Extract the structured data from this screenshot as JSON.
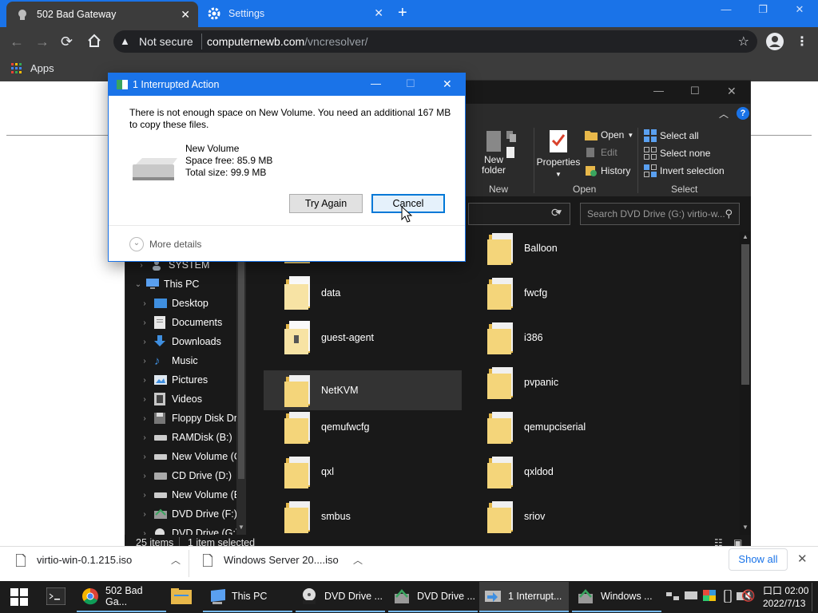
{
  "browser": {
    "tabs": [
      {
        "title": "502 Bad Gateway"
      },
      {
        "title": "Settings"
      }
    ],
    "security_label": "Not secure",
    "url_host": "computernewb.com",
    "url_path": "/vncresolver/",
    "bookmarks": {
      "apps_label": "Apps"
    }
  },
  "dialog": {
    "title": "1 Interrupted Action",
    "message": "There is not enough space on New Volume. You need an additional 167 MB to copy these files.",
    "drive_name": "New Volume",
    "space_free": "Space free: 85.9 MB",
    "total_size": "Total size: 99.9 MB",
    "try_again_label": "Try Again",
    "cancel_label": "Cancel",
    "more_details_label": "More details"
  },
  "explorer": {
    "ribbon": {
      "new_folder_label": "New folder",
      "properties_label": "Properties",
      "open_label": "Open",
      "edit_label": "Edit",
      "history_label": "History",
      "select_all_label": "Select all",
      "select_none_label": "Select none",
      "invert_selection_label": "Invert selection",
      "group_new": "New",
      "group_open": "Open",
      "group_select": "Select"
    },
    "search_placeholder": "Search DVD Drive (G:) virtio-w...",
    "nav": [
      {
        "label": "SYSTEM"
      },
      {
        "label": "This PC"
      },
      {
        "label": "Desktop"
      },
      {
        "label": "Documents"
      },
      {
        "label": "Downloads"
      },
      {
        "label": "Music"
      },
      {
        "label": "Pictures"
      },
      {
        "label": "Videos"
      },
      {
        "label": "Floppy Disk Dri"
      },
      {
        "label": "RAMDisk (B:)"
      },
      {
        "label": "New Volume (C"
      },
      {
        "label": "CD Drive (D:)"
      },
      {
        "label": "New Volume (E"
      },
      {
        "label": "DVD Drive (F:) I"
      },
      {
        "label": "DVD Drive (G:)"
      }
    ],
    "files_left": [
      {
        "name": ""
      },
      {
        "name": "data"
      },
      {
        "name": "guest-agent"
      },
      {
        "name": "NetKVM"
      },
      {
        "name": "qemufwcfg"
      },
      {
        "name": "qxl"
      },
      {
        "name": "smbus"
      }
    ],
    "files_right": [
      {
        "name": "Balloon"
      },
      {
        "name": "fwcfg"
      },
      {
        "name": "i386"
      },
      {
        "name": "pvpanic"
      },
      {
        "name": "qemupciserial"
      },
      {
        "name": "qxldod"
      },
      {
        "name": "sriov"
      }
    ],
    "status": {
      "item_count": "25 items",
      "selected": "1 item selected"
    }
  },
  "downloads": {
    "items": [
      {
        "name": "virtio-win-0.1.215.iso"
      },
      {
        "name": "Windows Server 20....iso"
      }
    ],
    "show_all_label": "Show all"
  },
  "taskbar": {
    "items": [
      {
        "label": "502 Bad Ga..."
      },
      {
        "label": "This PC"
      },
      {
        "label": "DVD Drive ..."
      },
      {
        "label": "DVD Drive ..."
      },
      {
        "label": "1 Interrupt..."
      },
      {
        "label": "Windows ..."
      }
    ],
    "time": "02:00",
    "date": "2022/7/13",
    "am_label": "口口"
  },
  "colors": {
    "chrome_blue": "#1a73e8",
    "chrome_dark": "#3c3c3c",
    "explorer_bg": "#191919",
    "folder_yellow": "#f4d57a"
  }
}
